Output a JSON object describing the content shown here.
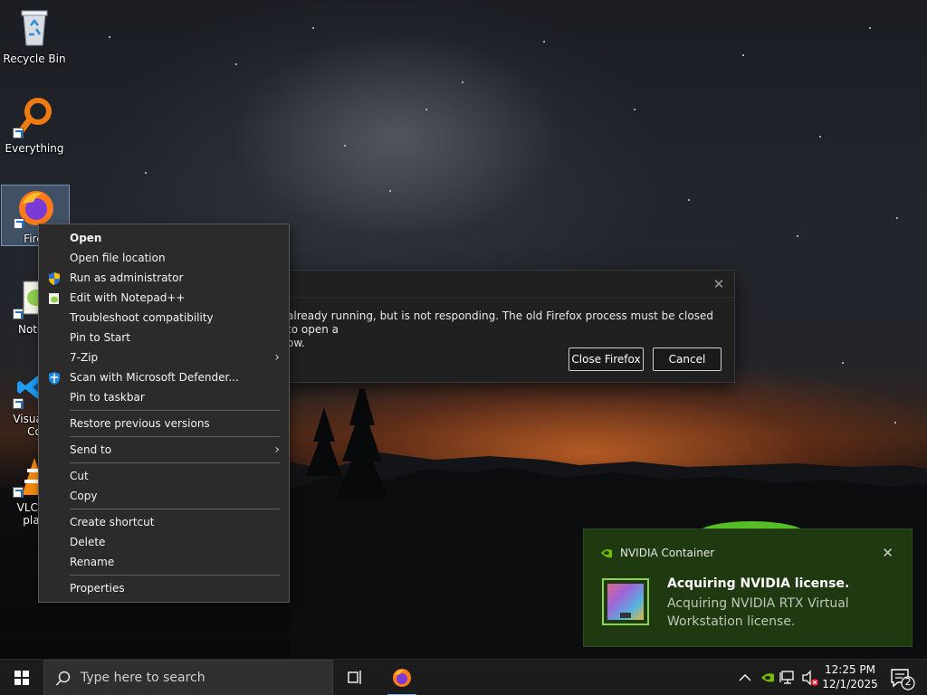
{
  "desktop": {
    "icons": [
      {
        "label": "Recycle Bin"
      },
      {
        "label": "Everything"
      },
      {
        "label": "Firefox",
        "visible_text": "Firef"
      },
      {
        "label": "Notepad++",
        "visible_text": "Notep"
      },
      {
        "label": "Visual Studio Code",
        "visible_text_line1": "Visual S",
        "visible_text_line2": "Co"
      },
      {
        "label": "VLC media player",
        "visible_text_line1": "VLC m",
        "visible_text_line2": "play"
      }
    ]
  },
  "dialog": {
    "message_line1": "already running, but is not responding. The old Firefox process must be closed to open a",
    "message_line2": "ow.",
    "close_button": "Close Firefox",
    "cancel_button": "Cancel",
    "close_glyph": "✕"
  },
  "context_menu": {
    "items": [
      {
        "label": "Open",
        "bold": true,
        "icon": ""
      },
      {
        "label": "Open file location",
        "icon": ""
      },
      {
        "label": "Run as administrator",
        "icon": "uac-shield-icon"
      },
      {
        "label": "Edit with Notepad++",
        "icon": "notepadpp-icon"
      },
      {
        "label": "Troubleshoot compatibility",
        "icon": ""
      },
      {
        "label": "Pin to Start",
        "icon": ""
      },
      {
        "label": "7-Zip",
        "icon": "",
        "submenu": true
      },
      {
        "label": "Scan with Microsoft Defender...",
        "icon": "defender-shield-icon"
      },
      {
        "label": "Pin to taskbar",
        "icon": ""
      },
      {
        "label": "Restore previous versions",
        "icon": ""
      },
      {
        "label": "Send to",
        "icon": "",
        "submenu": true
      },
      {
        "label": "Cut",
        "icon": ""
      },
      {
        "label": "Copy",
        "icon": ""
      },
      {
        "label": "Create shortcut",
        "icon": ""
      },
      {
        "label": "Delete",
        "icon": ""
      },
      {
        "label": "Rename",
        "icon": ""
      },
      {
        "label": "Properties",
        "icon": ""
      }
    ],
    "submenu_glyph": "›"
  },
  "notification": {
    "app_name": "NVIDIA Container",
    "title": "Acquiring NVIDIA license.",
    "body": "Acquiring NVIDIA RTX Virtual Workstation license.",
    "close_glyph": "✕",
    "accent": "#76b900"
  },
  "taskbar": {
    "search_placeholder": "Type here to search",
    "time": "12:25 PM",
    "date": "12/1/2025",
    "notification_count": "2",
    "accent": "#76b9ed"
  }
}
